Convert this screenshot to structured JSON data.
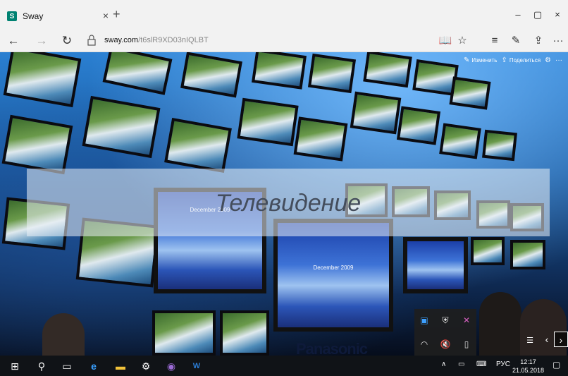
{
  "browser": {
    "tab": {
      "favicon_letter": "S",
      "title": "Sway",
      "close": "×"
    },
    "new_tab": "+",
    "window": {
      "minimize": "–",
      "maximize": "▢",
      "close": "×"
    },
    "nav": {
      "back": "←",
      "forward": "→",
      "refresh": "↻"
    },
    "url": {
      "domain": "sway.com",
      "path": "/t6slR9XD03nIQLBT"
    },
    "toolbar_glyphs": {
      "reading": "📖",
      "favorite": "☆",
      "hub": "≡",
      "notes": "✎",
      "share": "⇪",
      "more": "···"
    }
  },
  "sway": {
    "actions": {
      "edit_label": "Изменить",
      "share_label": "Поделиться",
      "more": "···"
    },
    "title": "Телевидение",
    "screen_caption": "December 2009",
    "brand": "Panasonic",
    "nav": {
      "prev": "‹",
      "next": "›"
    }
  },
  "taskbar": {
    "language": "РУС",
    "time": "12:17",
    "date": "21.05.2018"
  },
  "colors": {
    "sway_green": "#008272",
    "taskbar": "#101317"
  }
}
